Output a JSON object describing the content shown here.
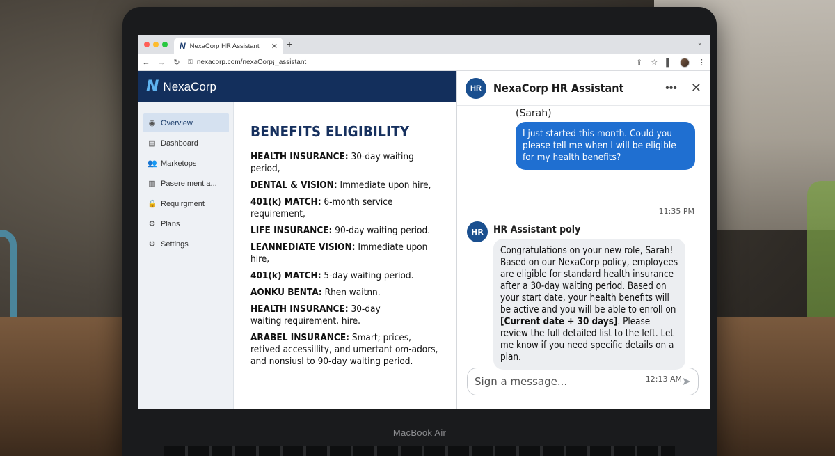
{
  "laptop": {
    "model_label": "MacBook Air"
  },
  "browser": {
    "tab_title": "NexaCorp HR Assistant",
    "tab_logo": "N",
    "url": "nexacorp.com/nexaCorp¡_assistant",
    "icons": [
      "back-icon",
      "forward-icon",
      "reload-icon",
      "lock-icon",
      "share-icon",
      "star-icon",
      "sidebar-icon",
      "profile-avatar",
      "menu-icon"
    ]
  },
  "brand": {
    "logo": "N",
    "name": "NexaCorp"
  },
  "sidebar": {
    "items": [
      {
        "label": "Overview",
        "icon": "◉",
        "active": true
      },
      {
        "label": "Dashboard",
        "icon": "▤"
      },
      {
        "label": "Marketops",
        "icon": "👥"
      },
      {
        "label": "Pasere ment a...",
        "icon": "▥"
      },
      {
        "label": "Requirgment",
        "icon": "🔒"
      },
      {
        "label": "Plans",
        "icon": "⚙"
      },
      {
        "label": "Settings",
        "icon": "⚙"
      }
    ]
  },
  "content": {
    "title": "BENEFITS ELIGIBILITY",
    "benefits": [
      {
        "label": "HEALTH INSURANCE:",
        "text": " 30-day waiting period,"
      },
      {
        "label": "DENTAL & VISION:",
        "text": " Immediate upon hire,"
      },
      {
        "label": "401(k) MATCH:",
        "text": " 6-month service requirement,"
      },
      {
        "label": "LIFE INSURANCE:",
        "text": " 90-day waiting period."
      },
      {
        "label": "LEΛNNEDIATE VISION:",
        "text": " Immediate upon hire,"
      },
      {
        "label": "401(k) MATCH:",
        "text": " 5-day waiting period."
      },
      {
        "label": "AONKU BENTA:",
        "text": " Rhen waitnn."
      },
      {
        "label": "HEALTH INSURANCE:",
        "text": " 30-day waiting requirement, hire."
      },
      {
        "label": "ARABEL INSURANCE:",
        "text": " Smart; prices, retived accessillity, and umertant om-adors, and nonsiusl to 90-day waiting period."
      }
    ]
  },
  "chat": {
    "title": "NexaCorp HR Assistant",
    "bot_avatar_text": "HR",
    "user_name": "(Sarah)",
    "user_message": "I just started this month. Could you please tell me when I will be eligible for my health benefits?",
    "user_time": "11:35 PM",
    "bot_name": "HR Assistant poly",
    "bot_message_part1": "Congratulations on your new role, Sarah! Based on our NexaCorp policy, employees are eligible for standard health insurance after a 30-day waiting period. Based on your start date, your health benefits will be active and you will be able to enroll on ",
    "bot_message_bold": "[Current date + 30 days]",
    "bot_message_part2": ". Please review the full detailed list to the left. Let me know if you need specific details on a plan.",
    "bot_time": "12:13 AM",
    "input_placeholder": "Sign a message..."
  }
}
